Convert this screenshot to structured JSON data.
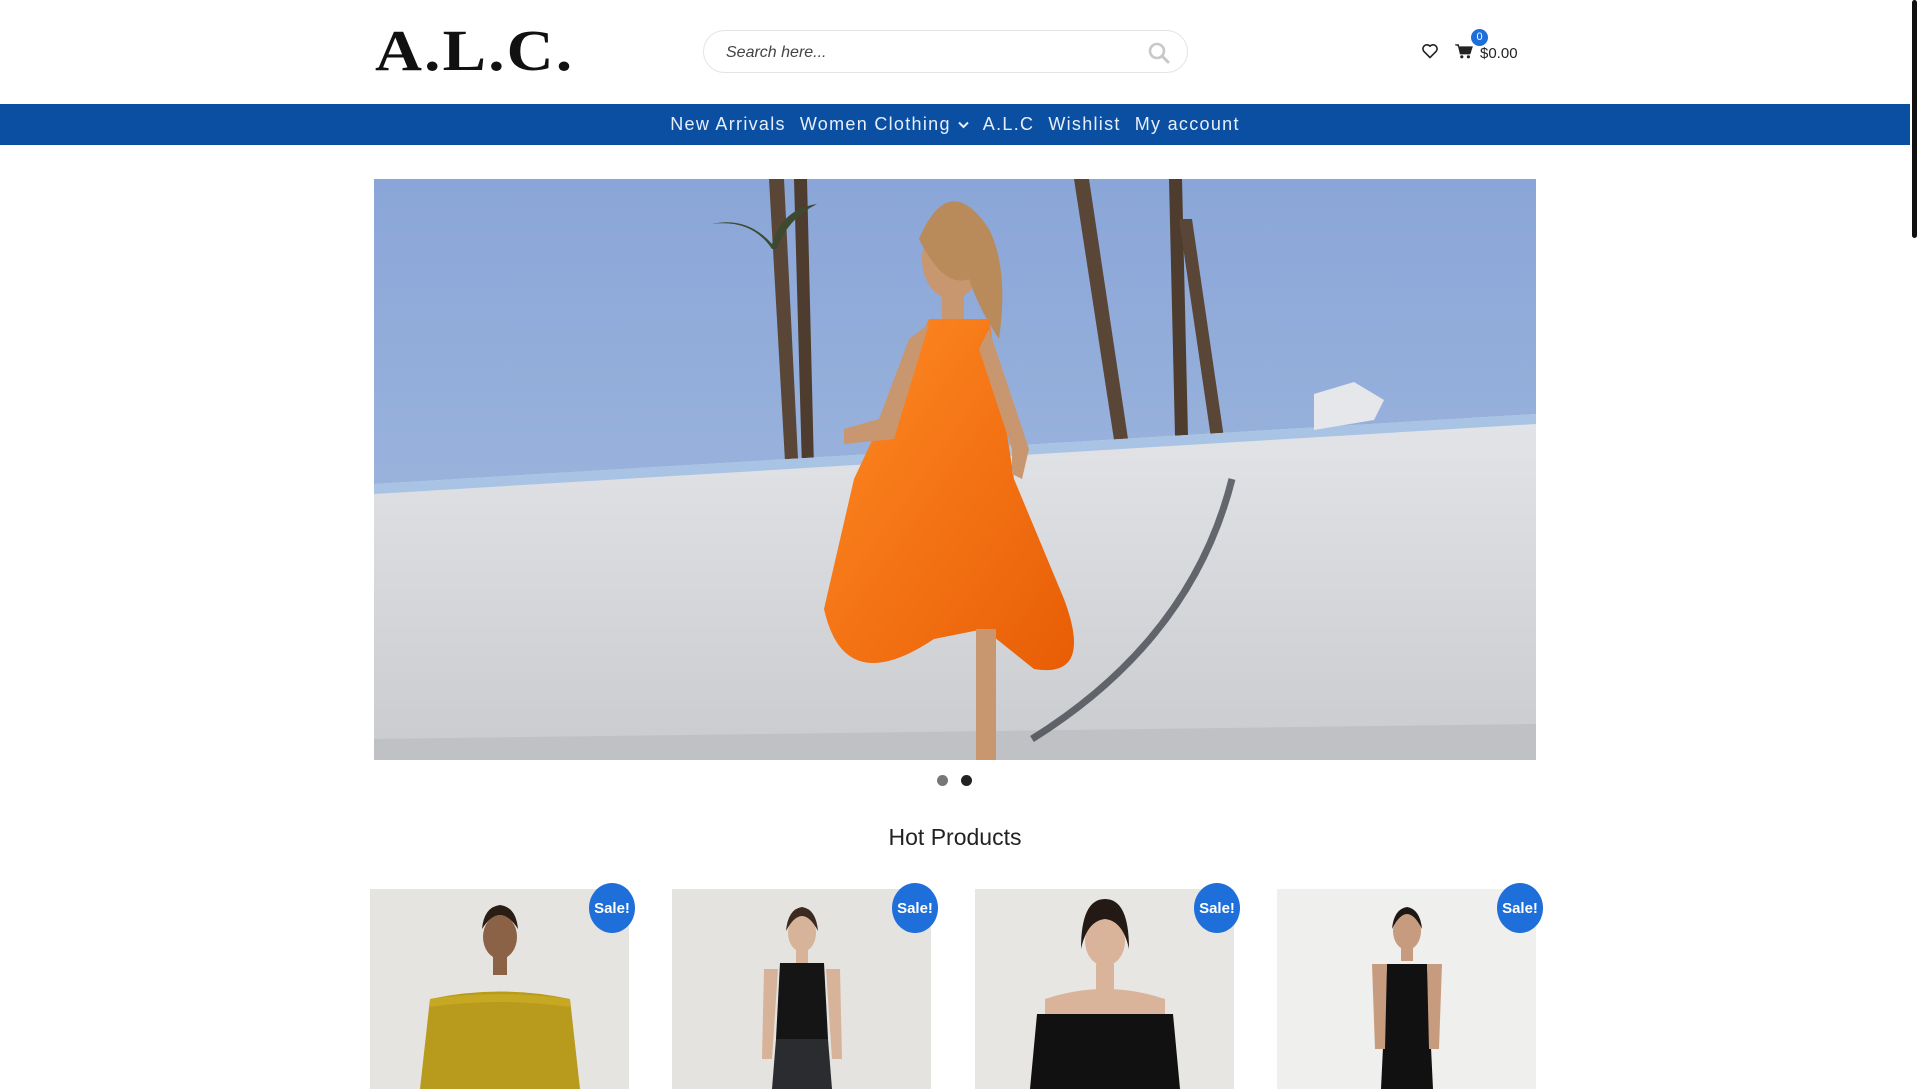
{
  "header": {
    "logo_text": "A.L.C.",
    "search_placeholder": "Search here...",
    "cart_total": "$0.00",
    "cart_count": "0"
  },
  "nav": {
    "items": [
      {
        "label": "New Arrivals"
      },
      {
        "label": "Women Clothing"
      },
      {
        "label": "A.L.C"
      },
      {
        "label": "Wishlist"
      },
      {
        "label": "My account"
      }
    ]
  },
  "slider": {
    "slide_count": 2,
    "active_slide": 2
  },
  "section": {
    "title": "Hot Products"
  },
  "products": [
    {
      "badge": "Sale!",
      "image": "model in mustard pleated off-shoulder top"
    },
    {
      "badge": "Sale!",
      "image": "model in black tank top and dark trousers"
    },
    {
      "badge": "Sale!",
      "image": "model in black strapless top"
    },
    {
      "badge": "Sale!",
      "image": "model in black pleated slip dress"
    }
  ],
  "colors": {
    "nav_bg": "#0b4fa3",
    "accent": "#1e6fd9"
  }
}
